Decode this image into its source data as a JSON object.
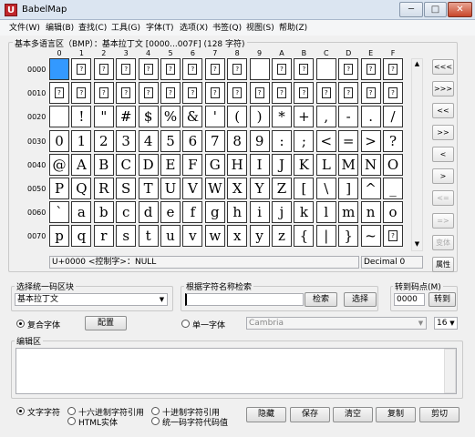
{
  "window": {
    "title": "BabelMap",
    "app_icon": "U"
  },
  "window_buttons": {
    "minimize": "─",
    "maximize": "□",
    "close": "✕"
  },
  "menu": [
    "文件(W)",
    "编辑(B)",
    "查找(C)",
    "工具(G)",
    "字体(T)",
    "选项(X)",
    "书签(Q)",
    "视图(S)",
    "帮助(Z)"
  ],
  "grid_group": {
    "label": "基本多语言区（BMP）：基本拉丁文 [0000...007F] (128 字符)"
  },
  "columns": [
    "0",
    "1",
    "2",
    "3",
    "4",
    "5",
    "6",
    "7",
    "8",
    "9",
    "A",
    "B",
    "C",
    "D",
    "E",
    "F"
  ],
  "rows": [
    {
      "label": "0000",
      "cells": [
        "sel",
        "?",
        "?",
        "?",
        "?",
        "?",
        "?",
        "?",
        "?",
        "",
        "?",
        "?",
        "",
        "?",
        "?",
        "?"
      ]
    },
    {
      "label": "0010",
      "cells": [
        "?",
        "?",
        "?",
        "?",
        "?",
        "?",
        "?",
        "?",
        "?",
        "?",
        "?",
        "?",
        "?",
        "?",
        "?",
        "?"
      ]
    },
    {
      "label": "0020",
      "cells": [
        "",
        "!",
        "\"",
        "#",
        "$",
        "%",
        "&",
        "'",
        "(",
        ")",
        "*",
        "+",
        ",",
        "-",
        ".",
        "/"
      ]
    },
    {
      "label": "0030",
      "cells": [
        "0",
        "1",
        "2",
        "3",
        "4",
        "5",
        "6",
        "7",
        "8",
        "9",
        ":",
        ";",
        "<",
        "=",
        ">",
        "?"
      ]
    },
    {
      "label": "0040",
      "cells": [
        "@",
        "A",
        "B",
        "C",
        "D",
        "E",
        "F",
        "G",
        "H",
        "I",
        "J",
        "K",
        "L",
        "M",
        "N",
        "O"
      ]
    },
    {
      "label": "0050",
      "cells": [
        "P",
        "Q",
        "R",
        "S",
        "T",
        "U",
        "V",
        "W",
        "X",
        "Y",
        "Z",
        "[",
        "\\",
        "]",
        "^",
        "_"
      ]
    },
    {
      "label": "0060",
      "cells": [
        "`",
        "a",
        "b",
        "c",
        "d",
        "e",
        "f",
        "g",
        "h",
        "i",
        "j",
        "k",
        "l",
        "m",
        "n",
        "o"
      ]
    },
    {
      "label": "0070",
      "cells": [
        "p",
        "q",
        "r",
        "s",
        "t",
        "u",
        "v",
        "w",
        "x",
        "y",
        "z",
        "{",
        "|",
        "}",
        "~",
        "?"
      ]
    }
  ],
  "placeholder_glyph": "?",
  "nav": [
    "<<<",
    ">>>",
    "<<",
    ">>",
    "<",
    ">",
    "<=",
    "=>",
    "变体",
    "属性"
  ],
  "status": {
    "char_info": "U+0000 <控制字>：NULL",
    "decimal": "Decimal 0"
  },
  "block_group": {
    "label": "选择统一码区块",
    "value": "基本拉丁文"
  },
  "search_group": {
    "label": "根据字符名称检索",
    "value": "",
    "search_btn": "检索",
    "select_btn": "选择"
  },
  "goto_group": {
    "label": "转到码点(M)",
    "value": "0000",
    "btn": "转到"
  },
  "font": {
    "composite": "复合字体",
    "configure": "配置",
    "single": "单一字体",
    "font_name": "Cambria",
    "size": "16"
  },
  "edit_group": {
    "label": "编辑区",
    "content": ""
  },
  "bottom": {
    "radio_text": "文字字符",
    "radio_hex": "十六进制字符引用",
    "radio_html": "HTML实体",
    "radio_dec": "十进制字符引用",
    "radio_code": "统一码字符代码值",
    "hide": "隐藏",
    "save": "保存",
    "clear": "清空",
    "copy": "复制",
    "cut": "剪切"
  }
}
